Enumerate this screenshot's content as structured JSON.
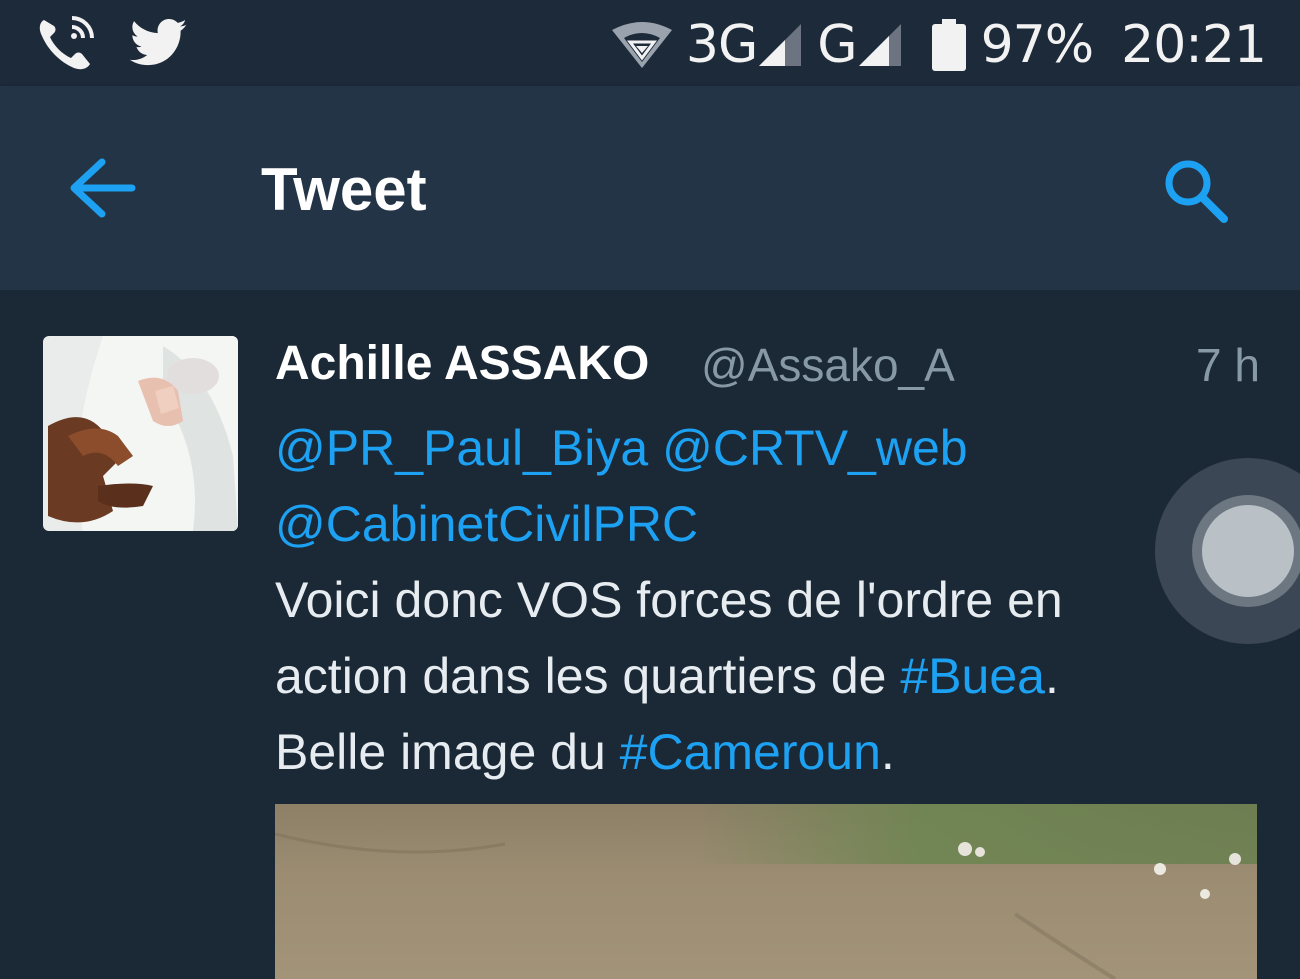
{
  "status_bar": {
    "left_icons": [
      "phone-wifi-icon",
      "twitter-bird-icon"
    ],
    "network_1": "3G",
    "network_2": "G",
    "battery_percent": "97%",
    "battery_level": 0.97,
    "time": "20:21"
  },
  "app_bar": {
    "title": "Tweet",
    "back_icon": "arrow-left-icon",
    "search_icon": "search-icon"
  },
  "tweet": {
    "author_name": "Achille ASSAKO",
    "author_handle": "@Assako_A",
    "timestamp": "7 h",
    "mentions_line1": [
      "@PR_Paul_Biya",
      "@CRTV_web"
    ],
    "mentions_line2": "@CabinetCivilPRC",
    "text_line1": "Voici donc VOS forces de l'ordre en",
    "text_line2_pre": "action dans les quartiers de ",
    "hashtag_1": "#Buea",
    "text_line2_post": ".",
    "text_line3_pre": "Belle image du ",
    "hashtag_2": "#Cameroun",
    "text_line3_post": "."
  },
  "colors": {
    "accent": "#1da1f2",
    "background": "#1b2836",
    "app_bar": "#243447",
    "secondary_text": "#8899a6"
  }
}
